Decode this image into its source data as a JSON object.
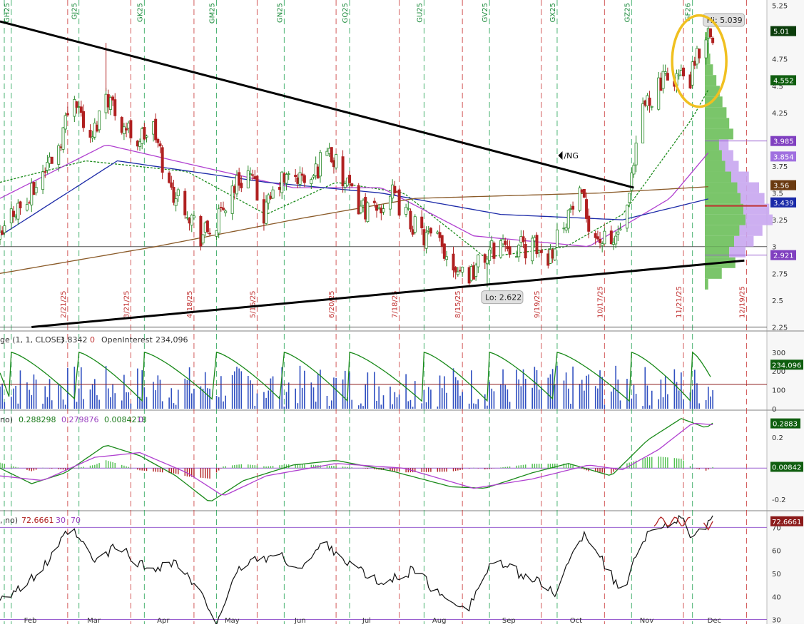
{
  "colors": {
    "up": "#2a8a2a",
    "down": "#b02020",
    "sma_fast": "#1a8a1a",
    "sma_mid": "#b040d0",
    "sma_slow": "#1c2aa8",
    "sma_long": "#8a5a28",
    "trend": "#000000",
    "vline_red": "#c83232",
    "vline_green": "#1ea050",
    "volume_bar": "#2f4fc0",
    "oi_line": "#1a8a1a",
    "volume_ref": "#8b1a1a",
    "macd_line": "#1a8a1a",
    "signal_line": "#b040d0",
    "rsi_line": "#111111",
    "rsi_over": "#b02020",
    "ob_line": "#9a60d0",
    "profile_green": "#6cbf5a",
    "profile_purple": "#c8a6f0",
    "label_green": "#1a6a1a",
    "label_brown": "#6a3a10",
    "label_blue": "#1a2aa8",
    "label_purple": "#8040c0",
    "callout": "#f0c020"
  },
  "chart_data": [
    {
      "type": "candlestick",
      "symbol_label": "/NG",
      "y_ticks": [
        "5.25",
        "5",
        "4.75",
        "4.5",
        "4.25",
        "4",
        "3.75",
        "3.5",
        "3.25",
        "3",
        "2.75",
        "2.5",
        "2.25"
      ],
      "ylim": [
        2.22,
        5.3
      ],
      "high_label": "Hi: 5.039",
      "low_label": "Lo: 2.622",
      "high_value": 5.039,
      "low_value": 2.622,
      "price_labels": [
        {
          "text": "5.01",
          "value": 5.01,
          "style": "dark-green"
        },
        {
          "text": "4.552",
          "value": 4.552,
          "style": "green"
        },
        {
          "text": "3.985",
          "value": 3.985,
          "style": "purple"
        },
        {
          "text": "3.854",
          "value": 3.854,
          "style": "light-purple"
        },
        {
          "text": "3.56",
          "value": 3.56,
          "style": "brown"
        },
        {
          "text": "3.439",
          "value": 3.439,
          "style": "blue"
        },
        {
          "text": "2.921",
          "value": 2.921,
          "style": "purple"
        }
      ],
      "contract_labels": [
        "GH25",
        "GJ25",
        "GK25",
        "GM25",
        "GN25",
        "GQ25",
        "GU25",
        "GV25",
        "GX25",
        "GZ25",
        "GF26"
      ],
      "expiry_dates": [
        "2/21/25",
        "3/21/25",
        "4/18/25",
        "5/16/25",
        "6/20/25",
        "7/18/25",
        "8/15/25",
        "9/19/25",
        "10/17/25",
        "11/21/25",
        "12/19/25"
      ],
      "month_labels": [
        "Feb",
        "Mar",
        "Apr",
        "May",
        "Jun",
        "Jul",
        "Aug",
        "Sep",
        "Oct",
        "Nov",
        "Dec"
      ],
      "horizontal_lines": [
        3.0,
        2.25
      ],
      "trendlines": [
        {
          "name": "upper-trendline",
          "from": {
            "date": "2025-01-22",
            "value": 5.1
          },
          "to": {
            "date": "2025-10-30",
            "value": 3.55
          }
        },
        {
          "name": "lower-trendline",
          "from": {
            "date": "2025-02-05",
            "value": 2.25
          },
          "to": {
            "date": "2025-12-18",
            "value": 2.87
          }
        }
      ],
      "close_anchors": [
        [
          "2025-01-22",
          3.05
        ],
        [
          "2025-01-28",
          3.35
        ],
        [
          "2025-02-03",
          3.4
        ],
        [
          "2025-02-10",
          3.7
        ],
        [
          "2025-02-17",
          3.95
        ],
        [
          "2025-02-24",
          4.45
        ],
        [
          "2025-03-03",
          3.95
        ],
        [
          "2025-03-10",
          4.45
        ],
        [
          "2025-03-17",
          4.15
        ],
        [
          "2025-03-24",
          4.0
        ],
        [
          "2025-03-31",
          4.1
        ],
        [
          "2025-04-07",
          3.55
        ],
        [
          "2025-04-14",
          3.4
        ],
        [
          "2025-04-21",
          3.1
        ],
        [
          "2025-04-28",
          3.2
        ],
        [
          "2025-05-05",
          3.55
        ],
        [
          "2025-05-12",
          3.7
        ],
        [
          "2025-05-19",
          3.3
        ],
        [
          "2025-05-26",
          3.6
        ],
        [
          "2025-06-02",
          3.65
        ],
        [
          "2025-06-09",
          3.6
        ],
        [
          "2025-06-16",
          3.95
        ],
        [
          "2025-06-23",
          3.6
        ],
        [
          "2025-06-30",
          3.4
        ],
        [
          "2025-07-07",
          3.3
        ],
        [
          "2025-07-14",
          3.5
        ],
        [
          "2025-07-21",
          3.3
        ],
        [
          "2025-07-28",
          3.1
        ],
        [
          "2025-08-04",
          3.05
        ],
        [
          "2025-08-11",
          2.85
        ],
        [
          "2025-08-18",
          2.75
        ],
        [
          "2025-08-25",
          2.9
        ],
        [
          "2025-09-01",
          3.05
        ],
        [
          "2025-09-08",
          3.0
        ],
        [
          "2025-09-15",
          3.0
        ],
        [
          "2025-09-22",
          2.9
        ],
        [
          "2025-09-29",
          3.25
        ],
        [
          "2025-10-06",
          3.45
        ],
        [
          "2025-10-13",
          3.1
        ],
        [
          "2025-10-20",
          3.0
        ],
        [
          "2025-10-27",
          3.3
        ],
        [
          "2025-11-03",
          4.3
        ],
        [
          "2025-11-10",
          4.5
        ],
        [
          "2025-11-17",
          4.6
        ],
        [
          "2025-11-24",
          4.55
        ],
        [
          "2025-12-01",
          5.01
        ]
      ],
      "ma_series": [
        {
          "key": "sma_fast",
          "points": [
            [
              "2025-01-22",
              3.6
            ],
            [
              "2025-03-01",
              3.8
            ],
            [
              "2025-04-15",
              3.7
            ],
            [
              "2025-05-20",
              3.3
            ],
            [
              "2025-06-20",
              3.6
            ],
            [
              "2025-07-20",
              3.5
            ],
            [
              "2025-08-25",
              2.9
            ],
            [
              "2025-09-30",
              3.0
            ],
            [
              "2025-10-25",
              3.3
            ],
            [
              "2025-11-25",
              4.2
            ],
            [
              "2025-12-03",
              4.5
            ]
          ]
        },
        {
          "key": "sma_mid",
          "points": [
            [
              "2025-01-22",
              3.45
            ],
            [
              "2025-03-10",
              3.95
            ],
            [
              "2025-04-20",
              3.75
            ],
            [
              "2025-06-01",
              3.55
            ],
            [
              "2025-07-10",
              3.55
            ],
            [
              "2025-08-20",
              3.1
            ],
            [
              "2025-10-10",
              3.0
            ],
            [
              "2025-11-15",
              3.45
            ],
            [
              "2025-12-03",
              3.9
            ]
          ]
        },
        {
          "key": "sma_slow",
          "points": [
            [
              "2025-01-22",
              3.1
            ],
            [
              "2025-03-15",
              3.8
            ],
            [
              "2025-05-20",
              3.6
            ],
            [
              "2025-07-10",
              3.5
            ],
            [
              "2025-09-01",
              3.3
            ],
            [
              "2025-10-25",
              3.25
            ],
            [
              "2025-12-03",
              3.45
            ]
          ]
        },
        {
          "key": "sma_long",
          "points": [
            [
              "2025-01-22",
              2.75
            ],
            [
              "2025-04-01",
              3.0
            ],
            [
              "2025-06-01",
              3.25
            ],
            [
              "2025-07-25",
              3.45
            ],
            [
              "2025-10-15",
              3.5
            ],
            [
              "2025-12-03",
              3.56
            ]
          ]
        }
      ],
      "profile": [
        [
          2.65,
          0.05
        ],
        [
          2.75,
          0.25
        ],
        [
          2.85,
          0.45
        ],
        [
          2.95,
          0.6
        ],
        [
          3.05,
          0.72
        ],
        [
          3.15,
          0.85
        ],
        [
          3.25,
          1.0
        ],
        [
          3.35,
          0.95
        ],
        [
          3.45,
          0.88
        ],
        [
          3.55,
          0.8
        ],
        [
          3.65,
          0.65
        ],
        [
          3.75,
          0.5
        ],
        [
          3.85,
          0.42
        ],
        [
          3.95,
          0.35
        ],
        [
          4.05,
          0.42
        ],
        [
          4.15,
          0.36
        ],
        [
          4.25,
          0.32
        ],
        [
          4.35,
          0.26
        ],
        [
          4.45,
          0.22
        ],
        [
          4.55,
          0.17
        ],
        [
          4.65,
          0.12
        ],
        [
          4.75,
          0.08
        ],
        [
          4.85,
          0.06
        ],
        [
          4.95,
          0.04
        ]
      ]
    },
    {
      "type": "bar",
      "title_prefix": "ge (1, 1, CLOSE)",
      "values_printed": [
        "3.8342",
        "0"
      ],
      "oi_label": "OpenInterest",
      "oi_value": "234,096",
      "y_ticks": [
        "300",
        "200",
        "100",
        "0"
      ],
      "ylim": [
        0,
        360
      ],
      "ref_line": 130,
      "last_label": "234.096",
      "oi_cycle": {
        "peak": 300,
        "trough": 30
      },
      "bar_base": 120,
      "bar_amp": 110
    },
    {
      "type": "line",
      "title_prefix": "no)",
      "values_printed": [
        "0.288298",
        "0.279876",
        "0.0084218",
        "0"
      ],
      "y_ticks": [
        "0.2",
        "-0.2"
      ],
      "y_tick_values": [
        0.2,
        -0.2
      ],
      "ylim": [
        -0.27,
        0.36
      ],
      "macd_points": [
        [
          "2025-01-22",
          0.0
        ],
        [
          "2025-02-05",
          -0.1
        ],
        [
          "2025-02-20",
          -0.03
        ],
        [
          "2025-03-10",
          0.15
        ],
        [
          "2025-03-25",
          0.08
        ],
        [
          "2025-04-10",
          -0.05
        ],
        [
          "2025-04-25",
          -0.22
        ],
        [
          "2025-05-10",
          -0.08
        ],
        [
          "2025-06-01",
          0.02
        ],
        [
          "2025-06-20",
          0.05
        ],
        [
          "2025-07-15",
          -0.02
        ],
        [
          "2025-08-10",
          -0.12
        ],
        [
          "2025-08-25",
          -0.13
        ],
        [
          "2025-09-15",
          -0.03
        ],
        [
          "2025-10-01",
          0.03
        ],
        [
          "2025-10-20",
          -0.05
        ],
        [
          "2025-11-05",
          0.18
        ],
        [
          "2025-11-20",
          0.32
        ],
        [
          "2025-12-01",
          0.26
        ],
        [
          "2025-12-04",
          0.29
        ]
      ],
      "signal_points": [
        [
          "2025-01-22",
          -0.05
        ],
        [
          "2025-02-10",
          -0.08
        ],
        [
          "2025-03-05",
          0.07
        ],
        [
          "2025-03-25",
          0.1
        ],
        [
          "2025-04-15",
          -0.03
        ],
        [
          "2025-05-01",
          -0.18
        ],
        [
          "2025-05-20",
          -0.05
        ],
        [
          "2025-06-20",
          0.03
        ],
        [
          "2025-07-20",
          0.0
        ],
        [
          "2025-08-20",
          -0.13
        ],
        [
          "2025-09-15",
          -0.07
        ],
        [
          "2025-10-10",
          0.02
        ],
        [
          "2025-10-25",
          -0.01
        ],
        [
          "2025-11-10",
          0.12
        ],
        [
          "2025-11-25",
          0.29
        ],
        [
          "2025-12-04",
          0.28
        ]
      ],
      "last_labels": [
        "0.2883",
        "0.00842"
      ],
      "last_values": [
        0.2883,
        0.00842
      ]
    },
    {
      "type": "line",
      "title_prefix": ", no)",
      "values_printed": [
        "72.6661",
        "30",
        "70"
      ],
      "y_ticks": [
        "70",
        "60",
        "50",
        "40",
        "30"
      ],
      "ylim": [
        28,
        76
      ],
      "levels": [
        70,
        30
      ],
      "rsi_points": [
        [
          "2025-01-22",
          40
        ],
        [
          "2025-02-03",
          45
        ],
        [
          "2025-02-15",
          58
        ],
        [
          "2025-02-22",
          70
        ],
        [
          "2025-03-05",
          55
        ],
        [
          "2025-03-15",
          62
        ],
        [
          "2025-03-28",
          52
        ],
        [
          "2025-04-10",
          55
        ],
        [
          "2025-04-20",
          42
        ],
        [
          "2025-04-28",
          30
        ],
        [
          "2025-05-10",
          55
        ],
        [
          "2025-05-25",
          58
        ],
        [
          "2025-06-05",
          52
        ],
        [
          "2025-06-15",
          64
        ],
        [
          "2025-06-25",
          55
        ],
        [
          "2025-07-10",
          45
        ],
        [
          "2025-07-25",
          52
        ],
        [
          "2025-08-05",
          40
        ],
        [
          "2025-08-18",
          36
        ],
        [
          "2025-08-28",
          55
        ],
        [
          "2025-09-10",
          50
        ],
        [
          "2025-09-25",
          42
        ],
        [
          "2025-10-08",
          68
        ],
        [
          "2025-10-15",
          58
        ],
        [
          "2025-10-25",
          40
        ],
        [
          "2025-11-01",
          63
        ],
        [
          "2025-11-10",
          71
        ],
        [
          "2025-11-20",
          73
        ],
        [
          "2025-11-26",
          65
        ],
        [
          "2025-12-04",
          72.7
        ]
      ],
      "last_label": "72.6661",
      "last_value": 72.6661
    }
  ]
}
